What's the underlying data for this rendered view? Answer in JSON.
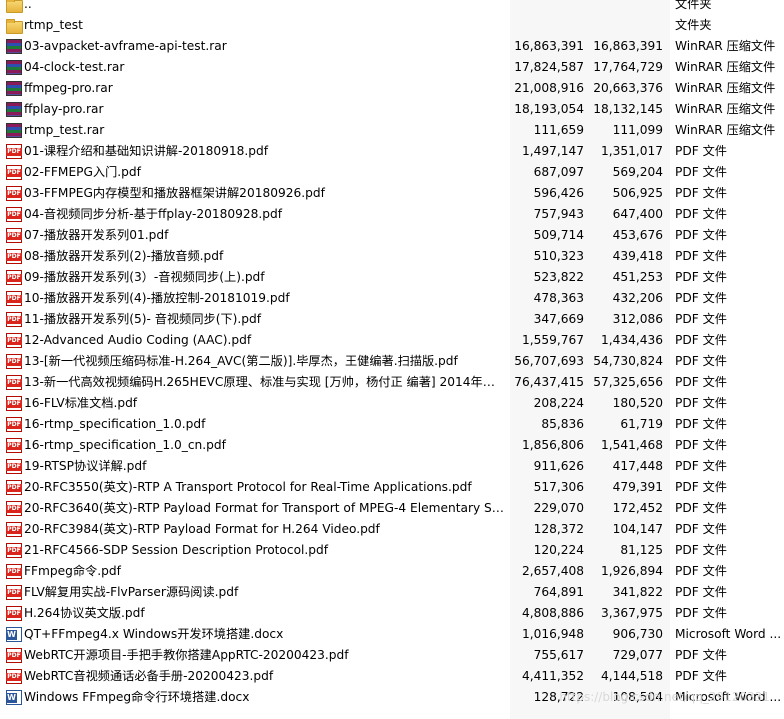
{
  "files": [
    {
      "name": "..",
      "size": "",
      "packed": "",
      "type": "文件夹",
      "icon": "folder-icon"
    },
    {
      "name": "rtmp_test",
      "size": "",
      "packed": "",
      "type": "文件夹",
      "icon": "folder-icon"
    },
    {
      "name": "03-avpacket-avframe-api-test.rar",
      "size": "16,863,391",
      "packed": "16,863,391",
      "type": "WinRAR 压缩文件",
      "icon": "rar-icon"
    },
    {
      "name": "04-clock-test.rar",
      "size": "17,824,587",
      "packed": "17,764,729",
      "type": "WinRAR 压缩文件",
      "icon": "rar-icon"
    },
    {
      "name": "ffmpeg-pro.rar",
      "size": "21,008,916",
      "packed": "20,663,376",
      "type": "WinRAR 压缩文件",
      "icon": "rar-icon"
    },
    {
      "name": "ffplay-pro.rar",
      "size": "18,193,054",
      "packed": "18,132,145",
      "type": "WinRAR 压缩文件",
      "icon": "rar-icon"
    },
    {
      "name": "rtmp_test.rar",
      "size": "111,659",
      "packed": "111,099",
      "type": "WinRAR 压缩文件",
      "icon": "rar-icon"
    },
    {
      "name": "01-课程介绍和基础知识讲解-20180918.pdf",
      "size": "1,497,147",
      "packed": "1,351,017",
      "type": "PDF 文件",
      "icon": "pdf-icon"
    },
    {
      "name": "02-FFMEPG入门.pdf",
      "size": "687,097",
      "packed": "569,204",
      "type": "PDF 文件",
      "icon": "pdf-icon"
    },
    {
      "name": "03-FFMPEG内存模型和播放器框架讲解20180926.pdf",
      "size": "596,426",
      "packed": "506,925",
      "type": "PDF 文件",
      "icon": "pdf-icon"
    },
    {
      "name": "04-音视频同步分析-基于ffplay-20180928.pdf",
      "size": "757,943",
      "packed": "647,400",
      "type": "PDF 文件",
      "icon": "pdf-icon"
    },
    {
      "name": "07-播放器开发系列01.pdf",
      "size": "509,714",
      "packed": "453,676",
      "type": "PDF 文件",
      "icon": "pdf-icon"
    },
    {
      "name": "08-播放器开发系列(2)-播放音频.pdf",
      "size": "510,323",
      "packed": "439,418",
      "type": "PDF 文件",
      "icon": "pdf-icon"
    },
    {
      "name": "09-播放器开发系列(3）-音视频同步(上).pdf",
      "size": "523,822",
      "packed": "451,253",
      "type": "PDF 文件",
      "icon": "pdf-icon"
    },
    {
      "name": "10-播放器开发系列(4)-播放控制-20181019.pdf",
      "size": "478,363",
      "packed": "432,206",
      "type": "PDF 文件",
      "icon": "pdf-icon"
    },
    {
      "name": "11-播放器开发系列(5)- 音视频同步(下).pdf",
      "size": "347,669",
      "packed": "312,086",
      "type": "PDF 文件",
      "icon": "pdf-icon"
    },
    {
      "name": "12-Advanced Audio Coding (AAC).pdf",
      "size": "1,559,767",
      "packed": "1,434,436",
      "type": "PDF 文件",
      "icon": "pdf-icon"
    },
    {
      "name": "13-[新一代视频压缩码标准-H.264_AVC(第二版)].毕厚杰，王健编著.扫描版.pdf",
      "size": "56,707,693",
      "packed": "54,730,824",
      "type": "PDF 文件",
      "icon": "pdf-icon"
    },
    {
      "name": "13-新一代高效视频编码H.265HEVC原理、标准与实现 [万帅，杨付正 编著] 2014年版.pdf",
      "size": "76,437,415",
      "packed": "57,325,656",
      "type": "PDF 文件",
      "icon": "pdf-icon"
    },
    {
      "name": "16-FLV标准文档.pdf",
      "size": "208,224",
      "packed": "180,520",
      "type": "PDF 文件",
      "icon": "pdf-icon"
    },
    {
      "name": "16-rtmp_specification_1.0.pdf",
      "size": "85,836",
      "packed": "61,719",
      "type": "PDF 文件",
      "icon": "pdf-icon"
    },
    {
      "name": "16-rtmp_specification_1.0_cn.pdf",
      "size": "1,856,806",
      "packed": "1,541,468",
      "type": "PDF 文件",
      "icon": "pdf-icon"
    },
    {
      "name": "19-RTSP协议详解.pdf",
      "size": "911,626",
      "packed": "417,448",
      "type": "PDF 文件",
      "icon": "pdf-icon"
    },
    {
      "name": "20-RFC3550(英文)-RTP A Transport Protocol for Real-Time Applications.pdf",
      "size": "517,306",
      "packed": "479,391",
      "type": "PDF 文件",
      "icon": "pdf-icon"
    },
    {
      "name": "20-RFC3640(英文)-RTP Payload Format for Transport of MPEG-4 Elementary Strea...",
      "size": "229,070",
      "packed": "172,452",
      "type": "PDF 文件",
      "icon": "pdf-icon"
    },
    {
      "name": "20-RFC3984(英文)-RTP Payload Format for H.264 Video.pdf",
      "size": "128,372",
      "packed": "104,147",
      "type": "PDF 文件",
      "icon": "pdf-icon"
    },
    {
      "name": "21-RFC4566-SDP Session  Description  Protocol.pdf",
      "size": "120,224",
      "packed": "81,125",
      "type": "PDF 文件",
      "icon": "pdf-icon"
    },
    {
      "name": "FFmpeg命令.pdf",
      "size": "2,657,408",
      "packed": "1,926,894",
      "type": "PDF 文件",
      "icon": "pdf-icon"
    },
    {
      "name": "FLV解复用实战-FlvParser源码阅读.pdf",
      "size": "764,891",
      "packed": "341,822",
      "type": "PDF 文件",
      "icon": "pdf-icon"
    },
    {
      "name": "H.264协议英文版.pdf",
      "size": "4,808,886",
      "packed": "3,367,975",
      "type": "PDF 文件",
      "icon": "pdf-icon"
    },
    {
      "name": "QT+FFmpeg4.x Windows开发环境搭建.docx",
      "size": "1,016,948",
      "packed": "906,730",
      "type": "Microsoft Word ...",
      "icon": "docx-icon"
    },
    {
      "name": "WebRTC开源项目-手把手教你搭建AppRTC-20200423.pdf",
      "size": "755,617",
      "packed": "729,077",
      "type": "PDF 文件",
      "icon": "pdf-icon"
    },
    {
      "name": "WebRTC音视频通话必备手册-20200423.pdf",
      "size": "4,411,352",
      "packed": "4,144,518",
      "type": "PDF 文件",
      "icon": "pdf-icon"
    },
    {
      "name": "Windows FFmpeg命令行环境搭建.docx",
      "size": "128,722",
      "packed": "108,504",
      "type": "Microsoft Word ...",
      "icon": "docx-icon"
    }
  ],
  "watermark": "https://blog.csdn.net/qq_29120331"
}
